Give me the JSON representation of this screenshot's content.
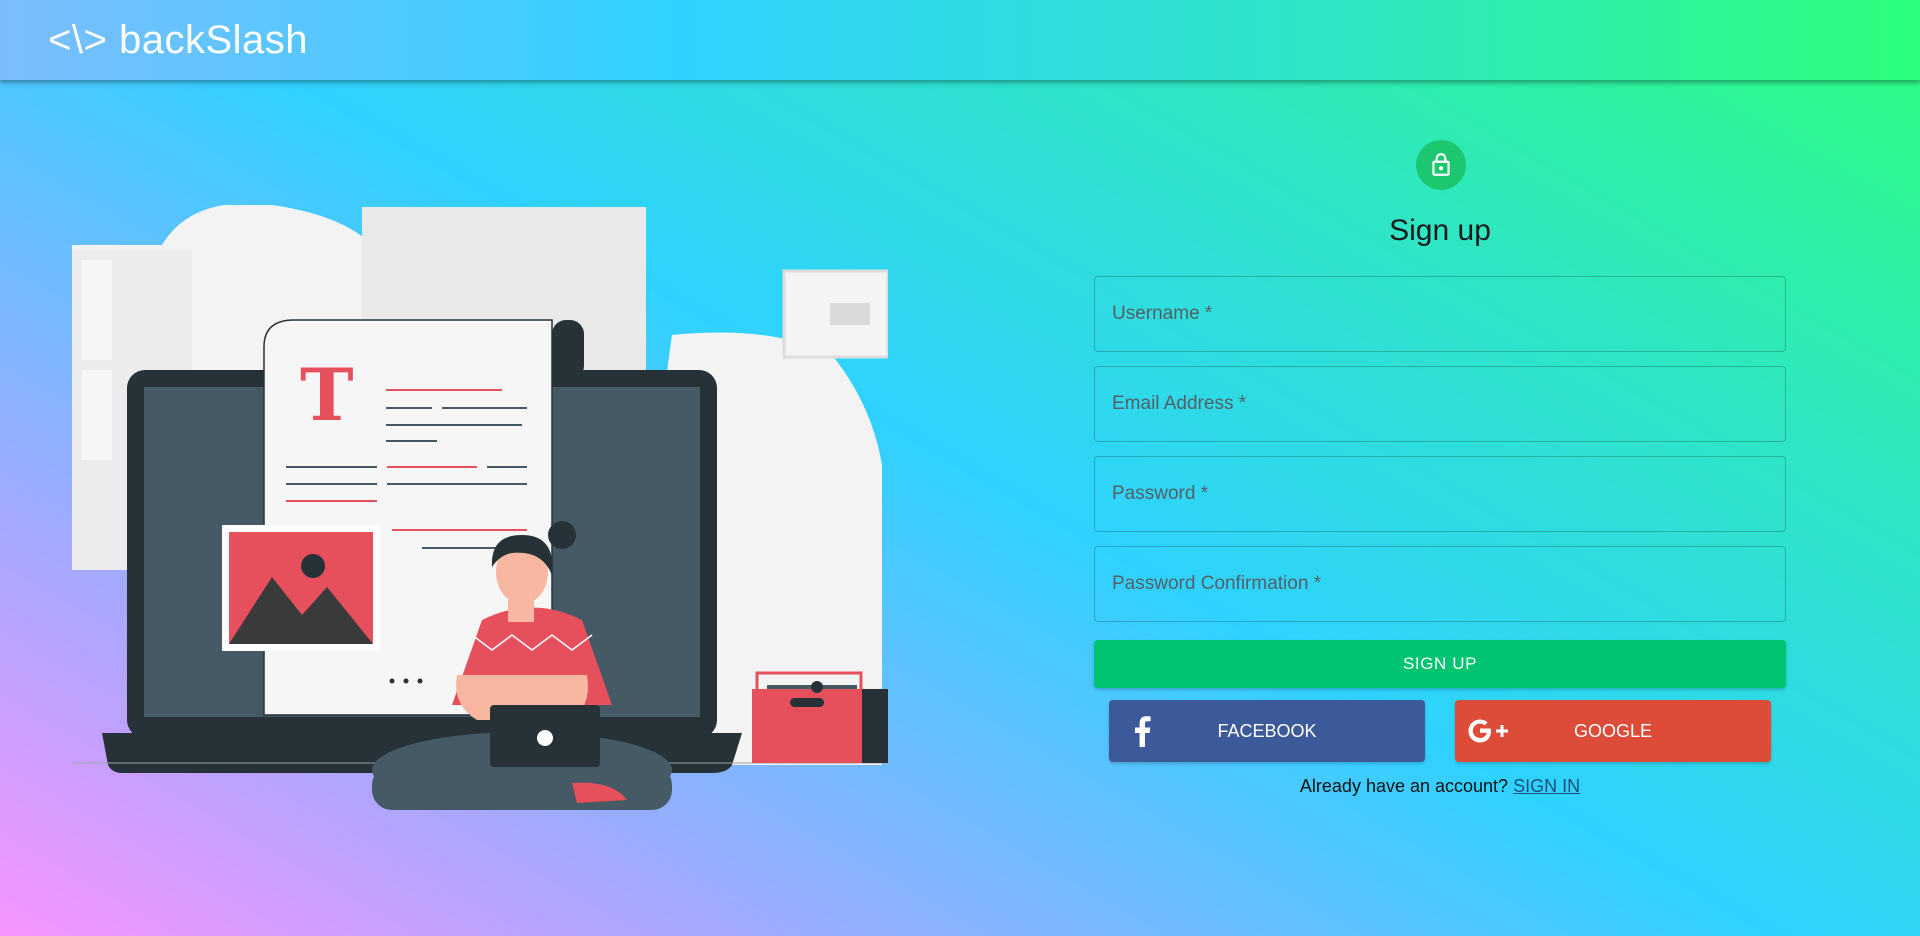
{
  "header": {
    "brand": "<\\> backSlash"
  },
  "illustration": {
    "name": "person-with-laptop-illustration"
  },
  "form": {
    "title": "Sign up",
    "fields": {
      "username_placeholder": "Username *",
      "email_placeholder": "Email Address *",
      "password_placeholder": "Password *",
      "password_confirmation_placeholder": "Password Confirmation *"
    },
    "signup_label": "SIGN UP",
    "facebook_label": "FACEBOOK",
    "google_label": "GOOGLE",
    "signin_prompt": "Already have an account?",
    "signin_link": "SIGN IN"
  },
  "icons": {
    "lock": "lock-icon",
    "facebook": "facebook-icon",
    "google": "google-plus-icon"
  },
  "colors": {
    "accent_green": "#00c46f",
    "facebook": "#3c5a99",
    "google": "#dd4b39",
    "link": "#1f4e79"
  }
}
